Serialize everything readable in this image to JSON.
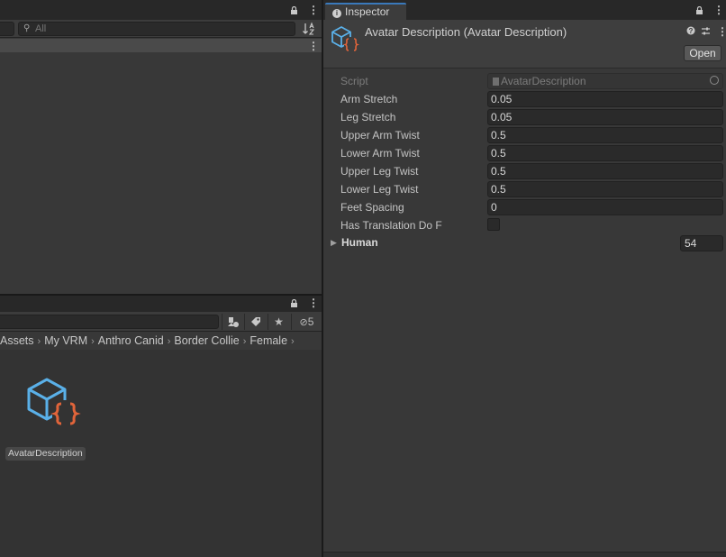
{
  "hierarchy": {
    "search_placeholder": "All"
  },
  "project": {
    "hidden_count": "5",
    "breadcrumb": [
      "Assets",
      "My VRM",
      "Anthro Canid",
      "Border Collie",
      "Female"
    ],
    "asset_label": "AvatarDescription"
  },
  "inspector": {
    "tab_label": "Inspector",
    "title": "Avatar Description (Avatar Description)",
    "open_label": "Open",
    "script_label": "Script",
    "script_value": "AvatarDescription",
    "fields": [
      {
        "label": "Arm Stretch",
        "value": "0.05"
      },
      {
        "label": "Leg Stretch",
        "value": "0.05"
      },
      {
        "label": "Upper Arm Twist",
        "value": "0.5"
      },
      {
        "label": "Lower Arm Twist",
        "value": "0.5"
      },
      {
        "label": "Upper Leg Twist",
        "value": "0.5"
      },
      {
        "label": "Lower Leg Twist",
        "value": "0.5"
      },
      {
        "label": "Feet Spacing",
        "value": "0"
      }
    ],
    "has_translation_label": "Has Translation Do F",
    "has_translation_checked": false,
    "human_label": "Human",
    "human_count": "54"
  },
  "colors": {
    "accent_tab": "#3a79bb",
    "icon_blue": "#5ab0e8",
    "icon_orange": "#e0643a"
  }
}
